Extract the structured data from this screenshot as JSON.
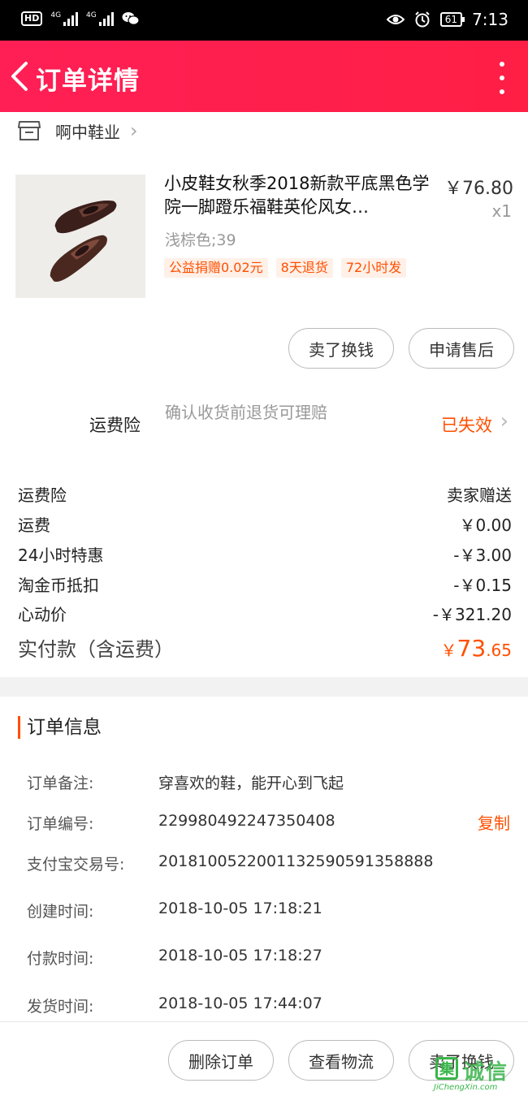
{
  "status_bar": {
    "hd": "HD",
    "signal_1": "4G",
    "signal_2": "4G",
    "battery": "61",
    "time": "7:13"
  },
  "header": {
    "title": "订单详情"
  },
  "shop": {
    "name": "啊中鞋业"
  },
  "product": {
    "title": "小皮鞋女秋季2018新款平底黑色学院一脚蹬乐福鞋英伦风女…",
    "price": "￥76.80",
    "qty": "x1",
    "sku": "浅棕色;39",
    "tags": [
      "公益捐赠0.02元",
      "8天退货",
      "72小时发"
    ]
  },
  "item_actions": {
    "sell_label": "卖了换钱",
    "after_sale_label": "申请售后"
  },
  "insurance": {
    "label": "运费险",
    "description": "确认收货前退货可理赔",
    "status": "已失效"
  },
  "fees": [
    {
      "label": "运费险",
      "value": "卖家赠送"
    },
    {
      "label": "运费",
      "value": "￥0.00"
    },
    {
      "label": "24小时特惠",
      "value": "-￥3.00"
    },
    {
      "label": "淘金币抵扣",
      "value": "-￥0.15"
    },
    {
      "label": "心动价",
      "value": "-￥321.20"
    }
  ],
  "total": {
    "label": "实付款（含运费）",
    "currency": "￥",
    "integer": "73",
    "decimal": ".65"
  },
  "order_info": {
    "title": "订单信息",
    "rows": [
      {
        "label": "订单备注:",
        "value": "穿喜欢的鞋，能开心到飞起"
      },
      {
        "label": "订单编号:",
        "value": "229980492247350408"
      },
      {
        "label": "支付宝交易号:",
        "value": "2018100522001132590591358888"
      },
      {
        "label": "创建时间:",
        "value": "2018-10-05 17:18:21"
      },
      {
        "label": "付款时间:",
        "value": "2018-10-05 17:18:27"
      },
      {
        "label": "发货时间:",
        "value": "2018-10-05 17:44:07"
      }
    ],
    "copy_label": "复制"
  },
  "bottom_actions": {
    "delete_label": "删除订单",
    "logistics_label": "查看物流",
    "sell_label": "卖了换钱"
  },
  "watermark": {
    "char": "集",
    "cn": "诚信",
    "url": "JiChengXin.com"
  },
  "colors": {
    "header": "#ff1f55",
    "accent": "#ff5000"
  }
}
